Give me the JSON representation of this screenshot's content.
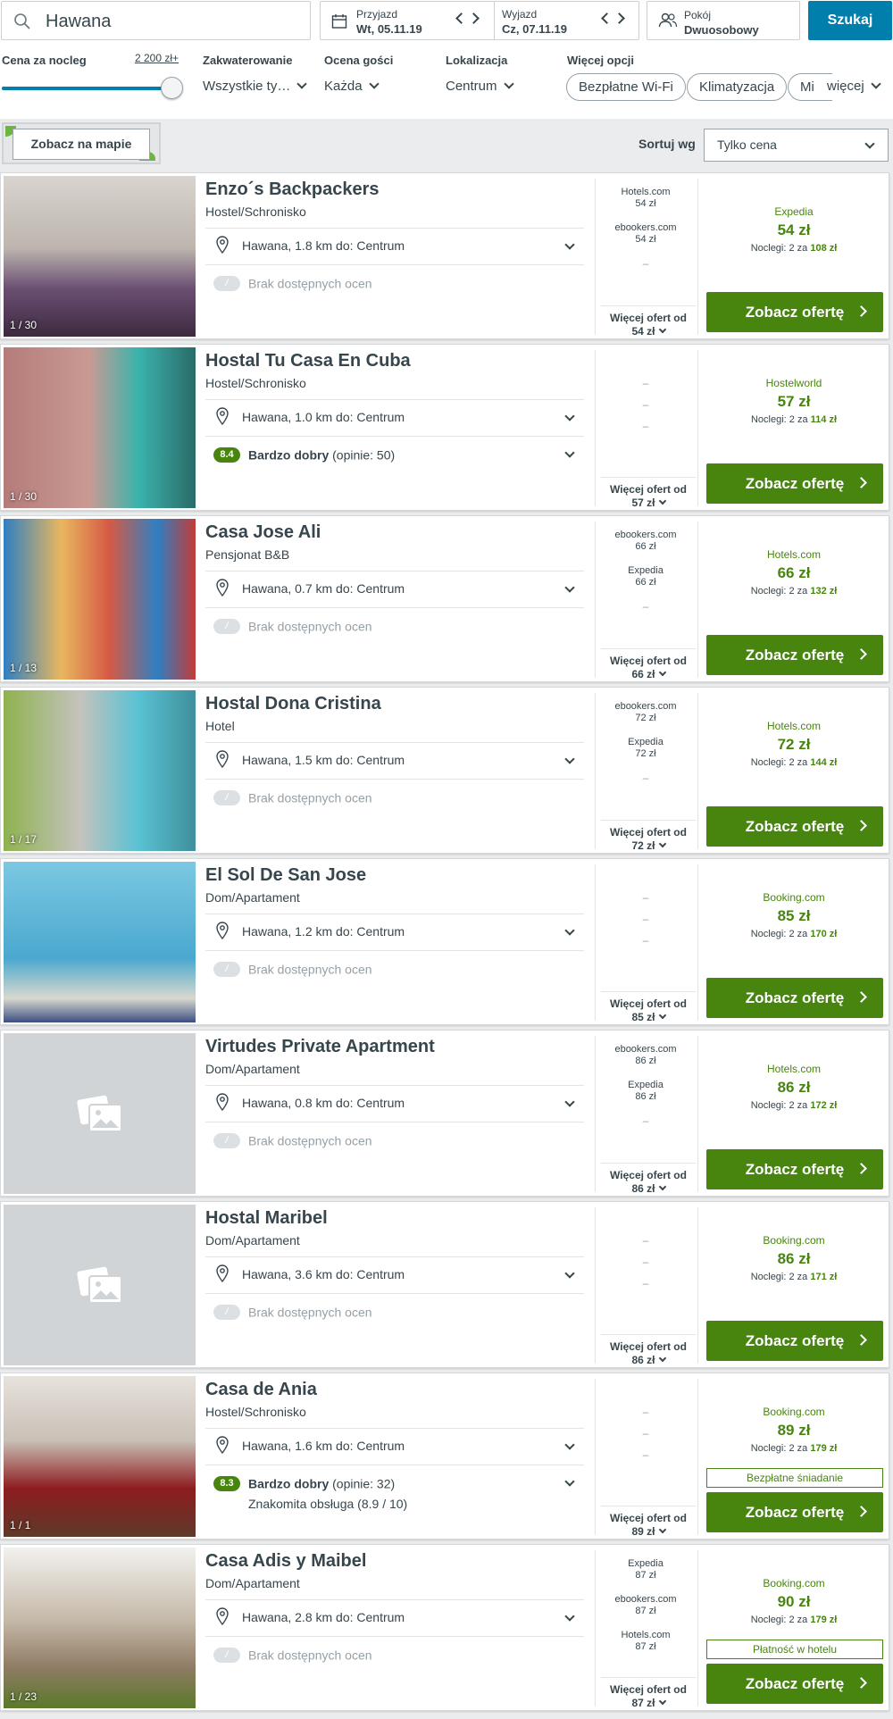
{
  "search": {
    "value": "Hawana"
  },
  "dates": {
    "checkin_label": "Przyjazd",
    "checkin_value": "Wt, 05.11.19",
    "checkout_label": "Wyjazd",
    "checkout_value": "Cz, 07.11.19"
  },
  "rooms": {
    "label": "Pokój",
    "value": "Dwuosobowy"
  },
  "search_button": "Szukaj",
  "filters": {
    "price_label": "Cena za nocleg",
    "price_value": "2 200 zł+",
    "price_fill": 0.93,
    "stay_label": "Zakwaterowanie",
    "stay_value": "Wszystkie ty…",
    "rating_label": "Ocena gości",
    "rating_value": "Każda",
    "location_label": "Lokalizacja",
    "location_value": "Centrum",
    "more_label": "Więcej opcji",
    "chips": [
      "Bezpłatne Wi-Fi",
      "Klimatyzacja",
      "Mi"
    ],
    "more_link": "więcej"
  },
  "map_button": "Zobacz na mapie",
  "sort": {
    "label": "Sortuj wg",
    "value": "Tylko cena"
  },
  "cta_label": "Zobacz ofertę",
  "more_offers_label": "Więcej ofert od",
  "no_rating_text": "Brak dostępnych ocen",
  "results": [
    {
      "name": "Enzo´s Backpackers",
      "type": "Hostel/Schronisko",
      "location": "Hawana, 1.8 km do: Centrum",
      "photo_count": "1 / 30",
      "offers": [
        {
          "provider": "Hotels.com",
          "price": "54 zł"
        },
        {
          "provider": "ebookers.com",
          "price": "54 zł"
        }
      ],
      "best": {
        "provider": "Expedia",
        "price": "54 zł",
        "nights": "Noclegi: 2 za",
        "total": "108 zł"
      },
      "more_price": "54 zł"
    },
    {
      "name": "Hostal Tu Casa En Cuba",
      "type": "Hostel/Schronisko",
      "location": "Hawana, 1.0 km do: Centrum",
      "photo_count": "1 / 30",
      "rating": {
        "score": "8.4",
        "label": "Bardzo dobry",
        "reviews": "(opinie: 50)"
      },
      "offers": [],
      "best": {
        "provider": "Hostelworld",
        "price": "57 zł",
        "nights": "Noclegi: 2 za",
        "total": "114 zł"
      },
      "more_price": "57 zł"
    },
    {
      "name": "Casa Jose Ali",
      "type": "Pensjonat B&B",
      "location": "Hawana, 0.7 km do: Centrum",
      "photo_count": "1 / 13",
      "offers": [
        {
          "provider": "ebookers.com",
          "price": "66 zł"
        },
        {
          "provider": "Expedia",
          "price": "66 zł"
        }
      ],
      "best": {
        "provider": "Hotels.com",
        "price": "66 zł",
        "nights": "Noclegi: 2 za",
        "total": "132 zł"
      },
      "more_price": "66 zł"
    },
    {
      "name": "Hostal Dona Cristina",
      "type": "Hotel",
      "location": "Hawana, 1.5 km do: Centrum",
      "photo_count": "1 / 17",
      "offers": [
        {
          "provider": "ebookers.com",
          "price": "72 zł"
        },
        {
          "provider": "Expedia",
          "price": "72 zł"
        }
      ],
      "best": {
        "provider": "Hotels.com",
        "price": "72 zł",
        "nights": "Noclegi: 2 za",
        "total": "144 zł"
      },
      "more_price": "72 zł"
    },
    {
      "name": "El Sol De San Jose",
      "type": "Dom/Apartament",
      "location": "Hawana, 1.2 km do: Centrum",
      "photo_count": "",
      "offers": [],
      "best": {
        "provider": "Booking.com",
        "price": "85 zł",
        "nights": "Noclegi: 2 za",
        "total": "170 zł"
      },
      "more_price": "85 zł"
    },
    {
      "name": "Virtudes Private Apartment",
      "type": "Dom/Apartament",
      "location": "Hawana, 0.8 km do: Centrum",
      "photo_count": "",
      "offers": [
        {
          "provider": "ebookers.com",
          "price": "86 zł"
        },
        {
          "provider": "Expedia",
          "price": "86 zł"
        }
      ],
      "best": {
        "provider": "Hotels.com",
        "price": "86 zł",
        "nights": "Noclegi: 2 za",
        "total": "172 zł"
      },
      "more_price": "86 zł"
    },
    {
      "name": "Hostal Maribel",
      "type": "Dom/Apartament",
      "location": "Hawana, 3.6 km do: Centrum",
      "photo_count": "",
      "offers": [],
      "best": {
        "provider": "Booking.com",
        "price": "86 zł",
        "nights": "Noclegi: 2 za",
        "total": "171 zł"
      },
      "more_price": "86 zł"
    },
    {
      "name": "Casa de Ania",
      "type": "Hostel/Schronisko",
      "location": "Hawana, 1.6 km do: Centrum",
      "photo_count": "1 / 1",
      "rating": {
        "score": "8.3",
        "label": "Bardzo dobry",
        "reviews": "(opinie: 32)",
        "extra": "Znakomita obsługa (8.9 / 10)"
      },
      "offers": [],
      "best": {
        "provider": "Booking.com",
        "price": "89 zł",
        "nights": "Noclegi: 2 za",
        "total": "179 zł"
      },
      "badge": "Bezpłatne śniadanie",
      "more_price": "89 zł"
    },
    {
      "name": "Casa Adis y Maibel",
      "type": "Dom/Apartament",
      "location": "Hawana, 2.8 km do: Centrum",
      "photo_count": "1 / 23",
      "offers": [
        {
          "provider": "Expedia",
          "price": "87 zł"
        },
        {
          "provider": "ebookers.com",
          "price": "87 zł"
        },
        {
          "provider": "Hotels.com",
          "price": "87 zł"
        }
      ],
      "best": {
        "provider": "Booking.com",
        "price": "90 zł",
        "nights": "Noclegi: 2 za",
        "total": "179 zł"
      },
      "badge": "Płatność w hotelu",
      "more_price": "87 zł"
    }
  ],
  "colors": {
    "primary": "#007fad",
    "deal_green": "#48850f",
    "text": "#37454d"
  }
}
